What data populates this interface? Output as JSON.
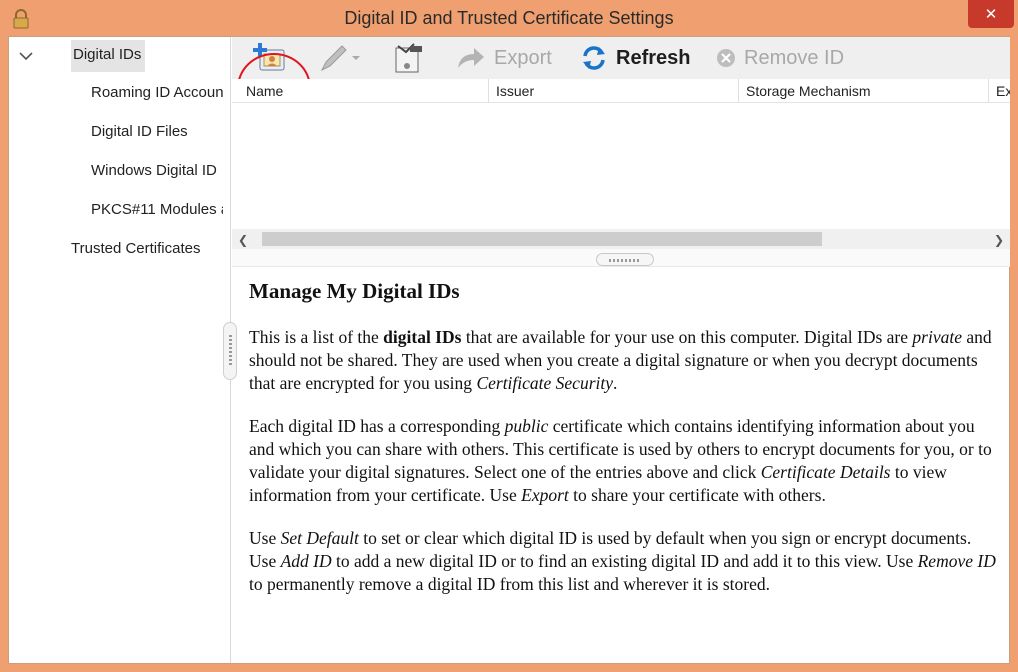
{
  "window": {
    "title": "Digital ID and Trusted Certificate Settings",
    "close_glyph": "✕"
  },
  "sidebar": {
    "items": [
      {
        "label": "Digital IDs",
        "selected": true,
        "expanded": true
      },
      {
        "label": "Roaming ID Accoun"
      },
      {
        "label": "Digital ID Files"
      },
      {
        "label": "Windows Digital ID"
      },
      {
        "label": "PKCS#11 Modules a"
      },
      {
        "label": "Trusted Certificates"
      }
    ]
  },
  "toolbar": {
    "add_id_icon": "add-id-icon",
    "usage_options_icon": "pen-icon",
    "certificate_details_icon": "certificate-details-icon",
    "export_label": "Export",
    "refresh_label": "Refresh",
    "remove_label": "Remove ID"
  },
  "table": {
    "columns": [
      "Name",
      "Issuer",
      "Storage Mechanism",
      "Ex"
    ]
  },
  "description": {
    "heading": "Manage My Digital IDs",
    "p1": {
      "a": "This is a list of the ",
      "b": "digital IDs",
      "c": " that are available for your use on this computer. Digital IDs are ",
      "d": "private",
      "e": " and should not be shared. They are used when you create a digital signature or when you decrypt documents that are encrypted for you using ",
      "f": "Certificate Security",
      "g": "."
    },
    "p2": {
      "a": "Each digital ID has a corresponding ",
      "b": "public",
      "c": " certificate which contains identifying information about you and which you can share with others. This certificate is used by others to encrypt documents for you, or to validate your digital signatures. Select one of the entries above and click ",
      "d": "Certificate Details",
      "e": " to view information from your certificate. Use ",
      "f": "Export",
      "g": " to share your certificate with others."
    },
    "p3": {
      "a": "Use ",
      "b": "Set Default",
      "c": " to set or clear which digital ID is used by default when you sign or encrypt documents. Use ",
      "d": "Add ID",
      "e": " to add a new digital ID or to find an existing digital ID and add it to this view. Use ",
      "f": "Remove ID",
      "g": " to permanently remove a digital ID from this list and wherever it is stored."
    }
  },
  "colors": {
    "frame": "#f0a070",
    "close": "#c7392b",
    "highlight_ring": "#e0141e",
    "refresh_blue": "#1a73c8"
  }
}
